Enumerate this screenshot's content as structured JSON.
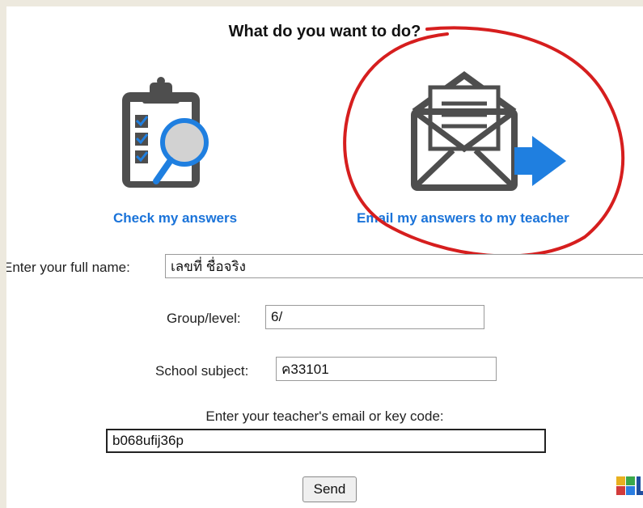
{
  "heading": "What do you want to do?",
  "options": {
    "check": {
      "label": "Check my answers",
      "icon": "clipboard-magnifier-icon"
    },
    "email": {
      "label": "Email my answers to my teacher",
      "icon": "envelope-arrow-icon"
    }
  },
  "form": {
    "full_name": {
      "label": "Enter your full name:",
      "value": "เลขที่ ชื่อจริง"
    },
    "group_level": {
      "label": "Group/level:",
      "value": "6/"
    },
    "school_subject": {
      "label": "School subject:",
      "value": "ค33101"
    },
    "teacher_email": {
      "label": "Enter your teacher's email or key code:",
      "value": "b068ufij36p"
    },
    "send_label": "Send"
  },
  "logo": {
    "letters": "LIVE",
    "colors": [
      "#e8b020",
      "#3aa84a",
      "#d23b3b",
      "#2a7de1"
    ]
  },
  "colors": {
    "link": "#1a73d9",
    "icon_gray": "#4e4e4e",
    "accent_blue": "#1f7fe0",
    "annotation_red": "#d61e1e"
  }
}
